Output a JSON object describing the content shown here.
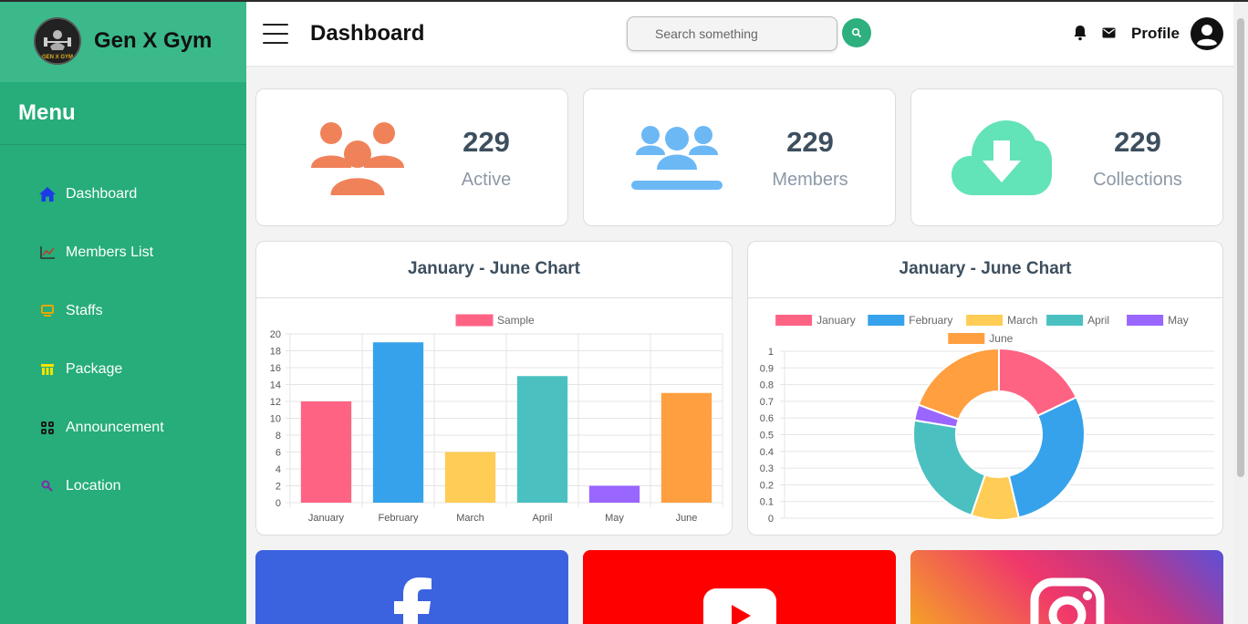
{
  "brand": {
    "name": "Gen X Gym",
    "logo_text": "GEN X GYM"
  },
  "sidebar": {
    "menu_title": "Menu",
    "items": [
      {
        "label": "Dashboard",
        "icon": "home-icon"
      },
      {
        "label": "Members List",
        "icon": "chart-line-icon"
      },
      {
        "label": "Staffs",
        "icon": "staff-icon"
      },
      {
        "label": "Package",
        "icon": "package-icon"
      },
      {
        "label": "Announcement",
        "icon": "grid-icon"
      },
      {
        "label": "Location",
        "icon": "search-icon"
      }
    ]
  },
  "header": {
    "title": "Dashboard",
    "search_placeholder": "Search something",
    "profile_label": "Profile"
  },
  "stats": [
    {
      "value": "229",
      "label": "Active",
      "icon": "users-icon",
      "color": "#f0825a"
    },
    {
      "value": "229",
      "label": "Members",
      "icon": "members-icon",
      "color": "#6cb8f5"
    },
    {
      "value": "229",
      "label": "Collections",
      "icon": "cloud-download-icon",
      "color": "#63e3b8"
    }
  ],
  "colors": {
    "sidebar": "#26ad79",
    "brand_bar": "#3bb98a",
    "facebook": "#3b63e0",
    "youtube": "#ff0000"
  },
  "chart_data": [
    {
      "type": "bar",
      "title": "January - June Chart",
      "categories": [
        "January",
        "February",
        "March",
        "April",
        "May",
        "June"
      ],
      "series": [
        {
          "name": "Sample",
          "values": [
            12,
            19,
            6,
            15,
            2,
            13
          ]
        }
      ],
      "colors": [
        "#ff6384",
        "#36a2eb",
        "#ffcd56",
        "#4bc0c0",
        "#9966ff",
        "#ff9f40"
      ],
      "ylim": [
        0,
        20
      ],
      "yticks": [
        "0",
        "2",
        "4",
        "6",
        "8",
        "10",
        "12",
        "14",
        "16",
        "18",
        "20"
      ],
      "legend": "top",
      "grid": true
    },
    {
      "type": "pie",
      "title": "January - June Chart",
      "categories": [
        "January",
        "February",
        "March",
        "April",
        "May",
        "June"
      ],
      "values": [
        12,
        19,
        6,
        15,
        2,
        13
      ],
      "colors": [
        "#ff6384",
        "#36a2eb",
        "#ffcd56",
        "#4bc0c0",
        "#9966ff",
        "#ff9f40"
      ],
      "ylim": [
        0,
        1
      ],
      "yticks": [
        "0",
        "0.1",
        "0.2",
        "0.3",
        "0.4",
        "0.5",
        "0.6",
        "0.7",
        "0.8",
        "0.9",
        "1"
      ],
      "legend": "top",
      "grid": true
    }
  ],
  "social": [
    {
      "name": "facebook",
      "icon": "facebook-icon"
    },
    {
      "name": "youtube",
      "icon": "youtube-icon"
    },
    {
      "name": "instagram",
      "icon": "instagram-icon"
    }
  ]
}
